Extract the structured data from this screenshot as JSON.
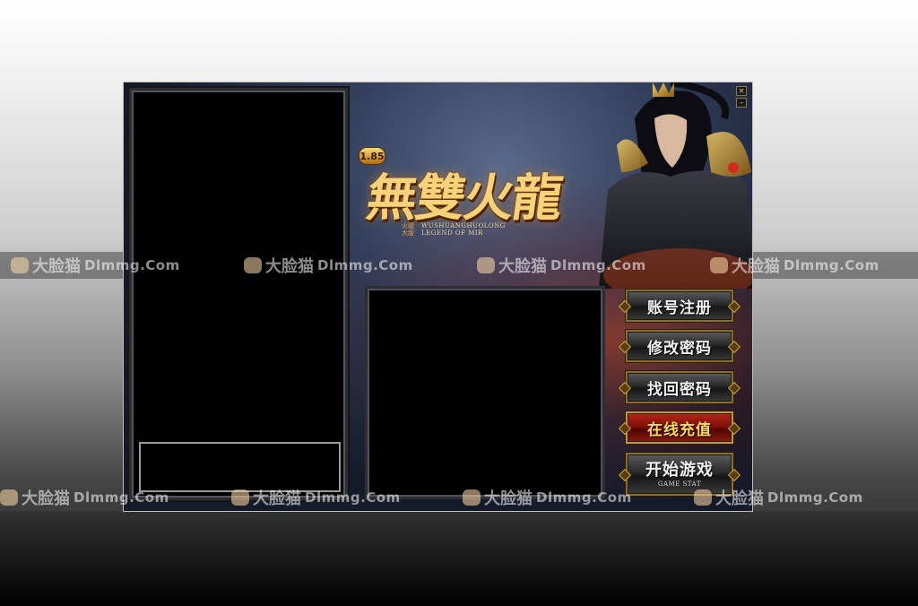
{
  "watermark": {
    "cn": "大脸猫",
    "latin": "Dlmmg.Com"
  },
  "logo": {
    "badge": "1.85",
    "title": "無雙火龍",
    "subtitle_cn": "火龍 大版",
    "subtitle_en_line1": "WUSHUANGHUOLONG",
    "subtitle_en_line2": "LEGEND OF MIR"
  },
  "window": {
    "close_glyph": "×",
    "minimize_glyph": "–"
  },
  "menu": {
    "register": "账号注册",
    "change_password": "修改密码",
    "recover_password": "找回密码",
    "recharge": "在线充值",
    "start_game": "开始游戏",
    "start_game_sub": "GAME STAT"
  },
  "colors": {
    "gold_border": "#8a6d2a",
    "recharge_red": "#7a0d06",
    "recharge_text": "#ffd76a"
  },
  "icons": [
    "cat-face-icon",
    "close-icon",
    "minimize-icon"
  ]
}
